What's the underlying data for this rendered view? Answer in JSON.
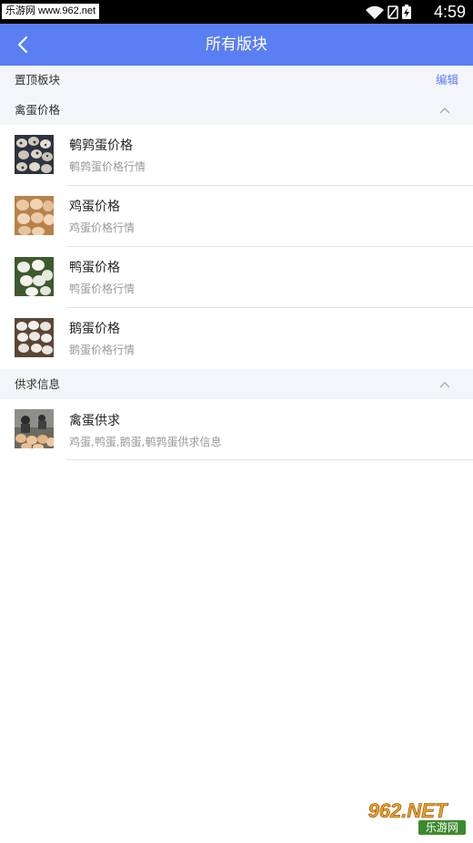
{
  "status_bar": {
    "watermark": "乐游网 www.962.net",
    "time": "4:59",
    "icons": [
      "wifi-icon",
      "no-sim-icon",
      "battery-icon"
    ]
  },
  "nav": {
    "back_icon": "chevron-left-icon",
    "title": "所有版块"
  },
  "pinned_section": {
    "title": "置顶板块",
    "edit_label": "编辑"
  },
  "sections": [
    {
      "title": "禽蛋价格",
      "collapse_icon": "chevron-up-icon",
      "items": [
        {
          "title": "鹌鹑蛋价格",
          "subtitle": "鹌鹑蛋价格行情",
          "thumb": "quail-egg-photo"
        },
        {
          "title": "鸡蛋价格",
          "subtitle": "鸡蛋价格行情",
          "thumb": "chicken-egg-photo"
        },
        {
          "title": "鸭蛋价格",
          "subtitle": "鸭蛋价格行情",
          "thumb": "duck-egg-photo"
        },
        {
          "title": "鹅蛋价格",
          "subtitle": "鹅蛋价格行情",
          "thumb": "goose-egg-photo"
        }
      ]
    },
    {
      "title": "供求信息",
      "collapse_icon": "chevron-up-icon",
      "items": [
        {
          "title": "禽蛋供求",
          "subtitle": "鸡蛋,鸭蛋,鹅蛋,鹌鹑蛋供求信息",
          "thumb": "egg-market-photo"
        }
      ]
    }
  ],
  "watermark_logo": {
    "text_top": "962.NET",
    "text_bottom": "乐游网"
  },
  "colors": {
    "accent": "#5a7ff2",
    "section_bg": "#f4f5f9",
    "divider": "#e3e3e3"
  }
}
